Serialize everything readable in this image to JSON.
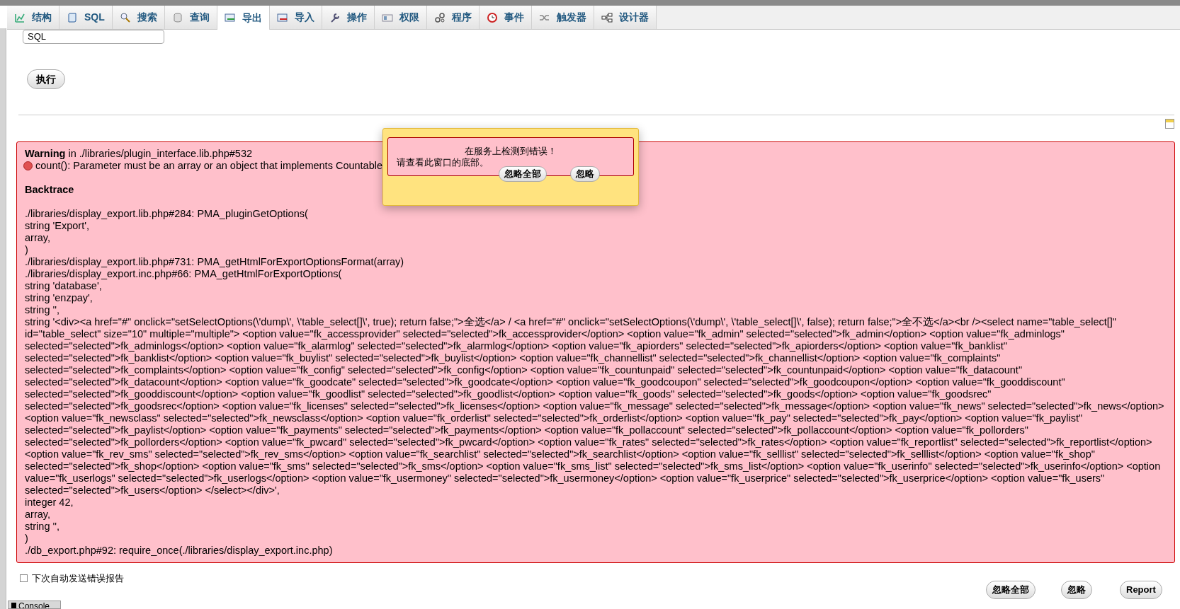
{
  "tabs": [
    {
      "label": "结构",
      "selected": false
    },
    {
      "label": "SQL",
      "selected": false
    },
    {
      "label": "搜索",
      "selected": false
    },
    {
      "label": "查询",
      "selected": false
    },
    {
      "label": "导出",
      "selected": true
    },
    {
      "label": "导入",
      "selected": false
    },
    {
      "label": "操作",
      "selected": false
    },
    {
      "label": "权限",
      "selected": false
    },
    {
      "label": "程序",
      "selected": false
    },
    {
      "label": "事件",
      "selected": false
    },
    {
      "label": "触发器",
      "selected": false
    },
    {
      "label": "设计器",
      "selected": false
    }
  ],
  "format_select": {
    "value": "SQL"
  },
  "execute_button": "执行",
  "error": {
    "heading": "**Warning** in ./libraries/plugin_interface.lib.php#532",
    "message": "count(): Parameter must be an array or an object that implements Countable",
    "backtrace_title": "Backtrace",
    "lines": [
      "./libraries/display_export.lib.php#284: PMA_pluginGetOptions(",
      "string 'Export',",
      "array,",
      ")",
      "./libraries/display_export.lib.php#731: PMA_getHtmlForExportOptionsFormat(array)",
      "./libraries/display_export.inc.php#66: PMA_getHtmlForExportOptions(",
      "string 'database',",
      "string 'enzpay',",
      "string '',",
      "string '<div><a href=\"#\" onclick=\"setSelectOptions(\\'dump\\', \\'table_select[]\\', true); return false;\">全选</a> / <a href=\"#\" onclick=\"setSelectOptions(\\'dump\\', \\'table_select[]\\', false); return false;\">全不选</a><br /><select name=\"table_select[]\"",
      "id=\"table_select\" size=\"10\" multiple=\"multiple\"> <option value=\"fk_accessprovider\" selected=\"selected\">fk_accessprovider</option> <option value=\"fk_admin\" selected=\"selected\">fk_admin</option> <option value=\"fk_adminlogs\"",
      "selected=\"selected\">fk_adminlogs</option> <option value=\"fk_alarmlog\" selected=\"selected\">fk_alarmlog</option> <option value=\"fk_apiorders\" selected=\"selected\">fk_apiorders</option> <option value=\"fk_banklist\"",
      "selected=\"selected\">fk_banklist</option> <option value=\"fk_buylist\" selected=\"selected\">fk_buylist</option> <option value=\"fk_channellist\" selected=\"selected\">fk_channellist</option> <option value=\"fk_complaints\"",
      "selected=\"selected\">fk_complaints</option> <option value=\"fk_config\" selected=\"selected\">fk_config</option> <option value=\"fk_countunpaid\" selected=\"selected\">fk_countunpaid</option> <option value=\"fk_datacount\"",
      "selected=\"selected\">fk_datacount</option> <option value=\"fk_goodcate\" selected=\"selected\">fk_goodcate</option> <option value=\"fk_goodcoupon\" selected=\"selected\">fk_goodcoupon</option> <option value=\"fk_gooddiscount\"",
      "selected=\"selected\">fk_gooddiscount</option> <option value=\"fk_goodlist\" selected=\"selected\">fk_goodlist</option> <option value=\"fk_goods\" selected=\"selected\">fk_goods</option> <option value=\"fk_goodsrec\"",
      "selected=\"selected\">fk_goodsrec</option> <option value=\"fk_licenses\" selected=\"selected\">fk_licenses</option> <option value=\"fk_message\" selected=\"selected\">fk_message</option> <option value=\"fk_news\" selected=\"selected\">fk_news</option>",
      "<option value=\"fk_newsclass\" selected=\"selected\">fk_newsclass</option> <option value=\"fk_orderlist\" selected=\"selected\">fk_orderlist</option> <option value=\"fk_pay\" selected=\"selected\">fk_pay</option> <option value=\"fk_paylist\"",
      "selected=\"selected\">fk_paylist</option> <option value=\"fk_payments\" selected=\"selected\">fk_payments</option> <option value=\"fk_pollaccount\" selected=\"selected\">fk_pollaccount</option> <option value=\"fk_pollorders\"",
      "selected=\"selected\">fk_pollorders</option> <option value=\"fk_pwcard\" selected=\"selected\">fk_pwcard</option> <option value=\"fk_rates\" selected=\"selected\">fk_rates</option> <option value=\"fk_reportlist\" selected=\"selected\">fk_reportlist</option>",
      "<option value=\"fk_rev_sms\" selected=\"selected\">fk_rev_sms</option> <option value=\"fk_searchlist\" selected=\"selected\">fk_searchlist</option> <option value=\"fk_selllist\" selected=\"selected\">fk_selllist</option> <option value=\"fk_shop\"",
      "selected=\"selected\">fk_shop</option> <option value=\"fk_sms\" selected=\"selected\">fk_sms</option> <option value=\"fk_sms_list\" selected=\"selected\">fk_sms_list</option> <option value=\"fk_userinfo\" selected=\"selected\">fk_userinfo</option> <option",
      "value=\"fk_userlogs\" selected=\"selected\">fk_userlogs</option> <option value=\"fk_usermoney\" selected=\"selected\">fk_usermoney</option> <option value=\"fk_userprice\" selected=\"selected\">fk_userprice</option> <option value=\"fk_users\"",
      "selected=\"selected\">fk_users</option> </select></div>',",
      "integer 42,",
      "array,",
      "string '',",
      ")",
      "./db_export.php#92: require_once(./libraries/display_export.inc.php)"
    ]
  },
  "popup": {
    "title": "在服务上检测到错误！",
    "message": "请查看此窗口的底部。",
    "buttons": [
      "忽略全部",
      "忽略"
    ]
  },
  "auto_report": {
    "label": "下次自动发送错误报告",
    "checked": false
  },
  "bottom_buttons": [
    "忽略全部",
    "忽略",
    "Report"
  ],
  "console_tab": "Console"
}
